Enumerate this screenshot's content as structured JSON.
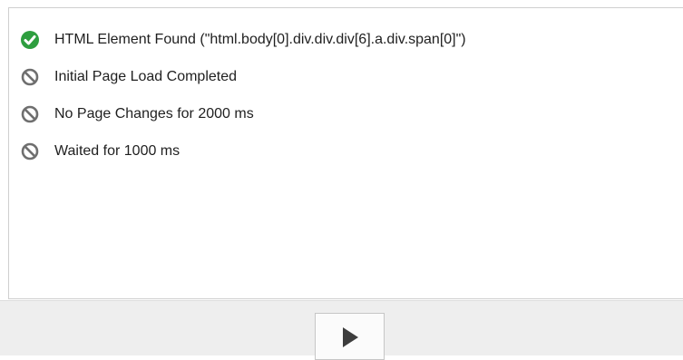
{
  "checks": [
    {
      "label": "HTML Element Found (\"html.body[0].div.div.div[6].a.div.span[0]\")",
      "status": "passed",
      "icon": "check-circle-icon"
    },
    {
      "label": "Initial Page Load Completed",
      "status": "skipped",
      "icon": "blocked-icon"
    },
    {
      "label": "No Page Changes for 2000 ms",
      "status": "skipped",
      "icon": "blocked-icon"
    },
    {
      "label": "Waited for 1000 ms",
      "status": "skipped",
      "icon": "blocked-icon"
    }
  ],
  "footer": {
    "run_button_icon": "play-icon"
  },
  "colors": {
    "passed": "#2e9e3f",
    "skipped": "#6f6f6f"
  }
}
